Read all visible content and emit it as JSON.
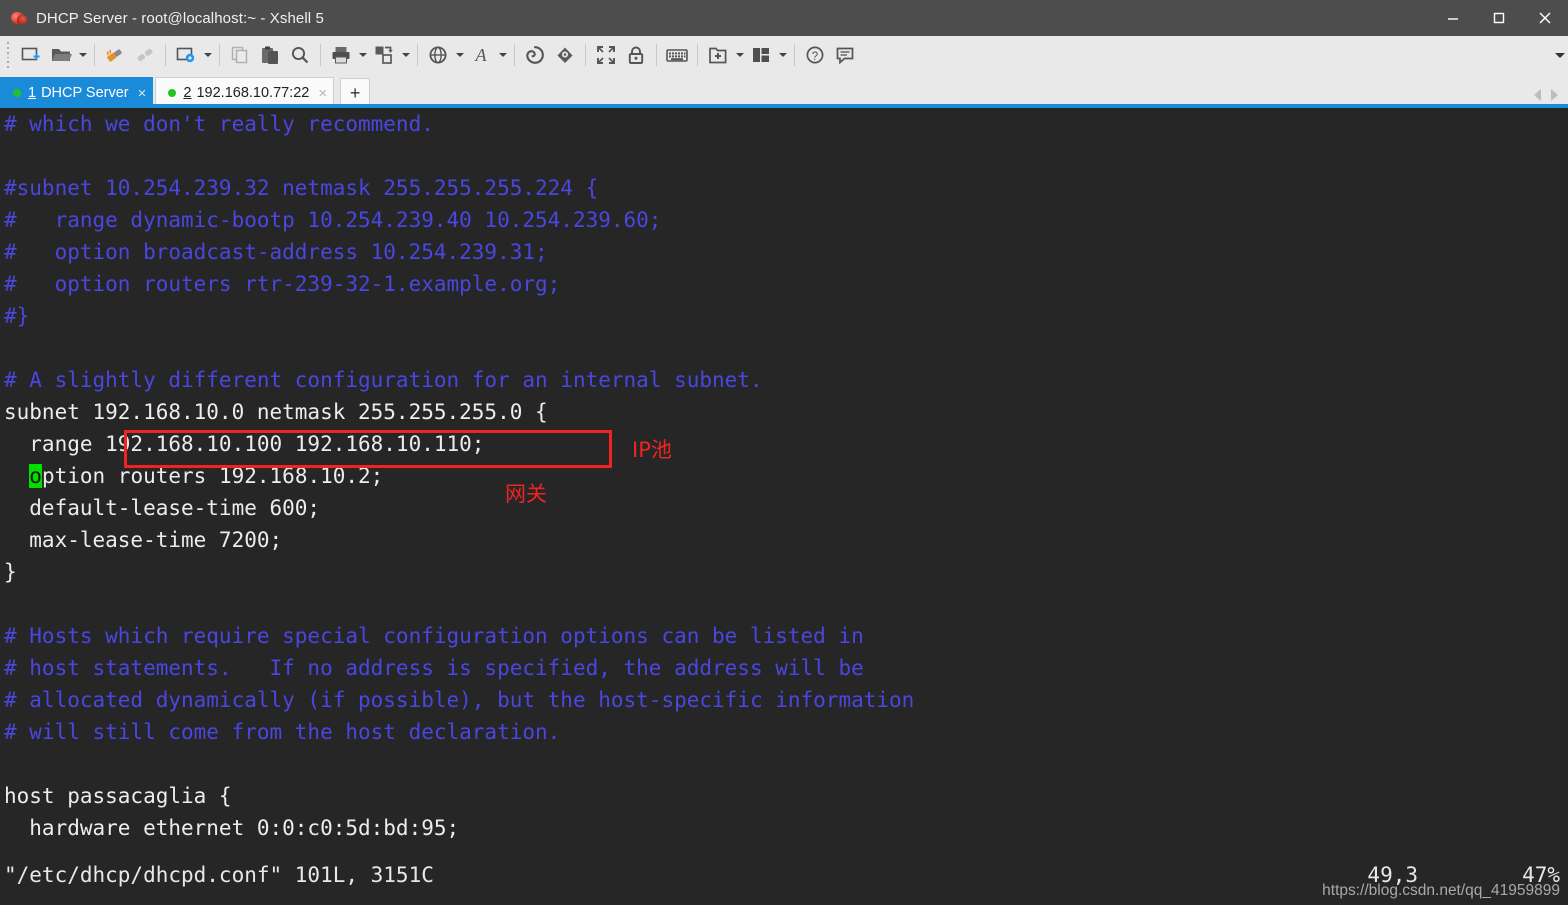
{
  "window": {
    "title": "DHCP Server - root@localhost:~ - Xshell 5",
    "app_icon": "xshell-snail-icon",
    "controls": {
      "minimize": "minimize-icon",
      "maximize": "maximize-icon",
      "close": "close-icon"
    }
  },
  "toolbar": {
    "overflow": "toolbar-overflow-chevron",
    "items": [
      {
        "icon": "new-session-icon",
        "caret": false
      },
      {
        "icon": "open-folder-icon",
        "caret": true
      },
      {
        "sep": true
      },
      {
        "icon": "connect-icon",
        "caret": false
      },
      {
        "icon": "disconnect-icon",
        "caret": false
      },
      {
        "sep": true
      },
      {
        "icon": "session-properties-icon",
        "caret": true
      },
      {
        "sep": true
      },
      {
        "icon": "copy-icon",
        "caret": false
      },
      {
        "icon": "paste-icon",
        "caret": false
      },
      {
        "icon": "find-icon",
        "caret": false
      },
      {
        "sep": true
      },
      {
        "icon": "print-icon",
        "caret": true
      },
      {
        "icon": "file-transfer-icon",
        "caret": true
      },
      {
        "sep": true
      },
      {
        "icon": "globe-icon",
        "caret": true
      },
      {
        "icon": "font-icon",
        "caret": true
      },
      {
        "sep": true
      },
      {
        "icon": "shell-green-icon",
        "caret": false
      },
      {
        "icon": "shell-blue-icon",
        "caret": false
      },
      {
        "sep": true
      },
      {
        "icon": "fullscreen-icon",
        "caret": false
      },
      {
        "icon": "lock-icon",
        "caret": false
      },
      {
        "sep": true
      },
      {
        "icon": "keyboard-icon",
        "caret": false
      },
      {
        "sep": true
      },
      {
        "icon": "add-to-folder-icon",
        "caret": true
      },
      {
        "icon": "layout-icon",
        "caret": true
      },
      {
        "sep": true
      },
      {
        "icon": "help-icon",
        "caret": false
      },
      {
        "icon": "feedback-icon",
        "caret": false
      }
    ]
  },
  "tabs": {
    "items": [
      {
        "number": "1",
        "label": "DHCP Server",
        "active": true,
        "status": "connected",
        "close": "×"
      },
      {
        "number": "2",
        "label": "192.168.10.77:22",
        "active": false,
        "status": "connected",
        "close": "×"
      }
    ],
    "add_label": "+",
    "nav_left": "tab-prev-icon",
    "nav_right": "tab-next-icon"
  },
  "terminal": {
    "lines": [
      {
        "text": "# which we don't really recommend.",
        "style": "cmt"
      },
      {
        "text": "",
        "style": "plain"
      },
      {
        "text": "#subnet 10.254.239.32 netmask 255.255.255.224 {",
        "style": "cmt"
      },
      {
        "text": "#   range dynamic-bootp 10.254.239.40 10.254.239.60;",
        "style": "cmt"
      },
      {
        "text": "#   option broadcast-address 10.254.239.31;",
        "style": "cmt"
      },
      {
        "text": "#   option routers rtr-239-32-1.example.org;",
        "style": "cmt"
      },
      {
        "text": "#}",
        "style": "cmt"
      },
      {
        "text": "",
        "style": "plain"
      },
      {
        "text": "# A slightly different configuration for an internal subnet.",
        "style": "cmt"
      },
      {
        "text": "subnet 192.168.10.0 netmask 255.255.255.0 {",
        "style": "plain"
      },
      {
        "text": "  range 192.168.10.100 192.168.10.110;",
        "style": "plain"
      },
      {
        "text": "  option routers 192.168.10.2;",
        "style": "plain",
        "cursor_col": 2
      },
      {
        "text": "  default-lease-time 600;",
        "style": "plain"
      },
      {
        "text": "  max-lease-time 7200;",
        "style": "plain"
      },
      {
        "text": "}",
        "style": "plain"
      },
      {
        "text": "",
        "style": "plain"
      },
      {
        "text": "# Hosts which require special configuration options can be listed in",
        "style": "cmt"
      },
      {
        "text": "# host statements.   If no address is specified, the address will be",
        "style": "cmt"
      },
      {
        "text": "# allocated dynamically (if possible), but the host-specific information",
        "style": "cmt"
      },
      {
        "text": "# will still come from the host declaration.",
        "style": "cmt"
      },
      {
        "text": "",
        "style": "plain"
      },
      {
        "text": "host passacaglia {",
        "style": "plain"
      },
      {
        "text": "  hardware ethernet 0:0:c0:5d:bd:95;",
        "style": "plain"
      }
    ],
    "status": {
      "file": "\"/etc/dhcp/dhcpd.conf\" 101L, 3151C",
      "position": "49,3",
      "percent": "47%"
    },
    "watermark": "https://blog.csdn.net/qq_41959899"
  },
  "annotations": [
    {
      "name": "ip-pool-label",
      "text": "IP池"
    },
    {
      "name": "gateway-label",
      "text": "网关"
    }
  ],
  "colors": {
    "accent": "#1a8bd8",
    "terminal_bg": "#262626",
    "comment": "#4a46e0",
    "cursor": "#00e000",
    "annotation": "#ee2424",
    "titlebar": "#4d4d4d"
  }
}
